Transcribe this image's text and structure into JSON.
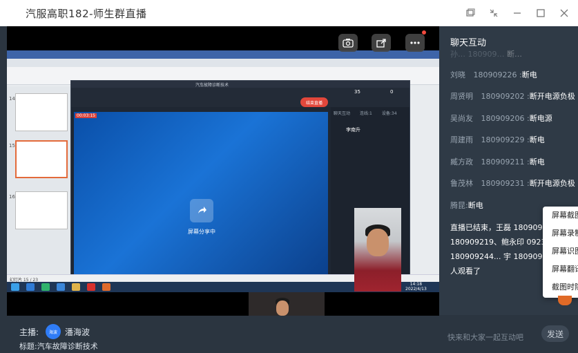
{
  "window": {
    "title": "汽服高职182-师生群直播",
    "controls": [
      "restore-window-icon",
      "shrink-icon",
      "minimize-icon",
      "maximize-icon",
      "close-icon"
    ]
  },
  "video": {
    "buttons": [
      "camera-switch-icon",
      "share-icon",
      "more-icon"
    ],
    "inner_window_title": "汽车故障诊断技术",
    "share_label": "屏幕分享中",
    "live_timer": "00:03:15",
    "inner_stats": [
      {
        "value": "35"
      },
      {
        "value": "0"
      }
    ],
    "inner_end_label": "结束直播",
    "inner_tabs": [
      "聊天互动",
      "连线:1",
      "设备:34"
    ],
    "inner_user": "李南升",
    "slide_numbers": [
      "14",
      "15",
      "16"
    ],
    "office_page_status": "幻灯片 15 / 23",
    "taskbar_time": "14:18",
    "taskbar_date": "2022/4/13"
  },
  "footer": {
    "host_prefix": "主播:",
    "host_avatar": "海波",
    "host_name": "潘海波",
    "topic_prefix": "标题:",
    "topic": "汽车故障诊断技术"
  },
  "chat": {
    "title": "聊天互动",
    "messages": [
      {
        "name": "刘晓",
        "id": "180909226",
        "text": "断电"
      },
      {
        "name": "周贤明",
        "id": "180909202",
        "text": "断开电源负极"
      },
      {
        "name": "吴尚友",
        "id": "180909206",
        "text": "断电源"
      },
      {
        "name": "周建雨",
        "id": "180909229",
        "text": "断电"
      },
      {
        "name": "臧方政",
        "id": "180909211",
        "text": "断电"
      },
      {
        "name": "鲁茂林",
        "id": "180909231",
        "text": "断开电源负极"
      },
      {
        "name": "腾昆",
        "id": "",
        "text": "断电"
      }
    ],
    "system_message": "直播已结束，王磊 180909... 李皓 180909219、鲍永印 09239、王帅波 180909244... 宇 180909238等35人观看了",
    "input_placeholder": "快来和大家一起互动吧",
    "send_label": "发送"
  },
  "context_menu": {
    "items": [
      "屏幕截图",
      "屏幕录制",
      "屏幕识图",
      "屏幕翻译",
      "截图时隐藏"
    ]
  }
}
